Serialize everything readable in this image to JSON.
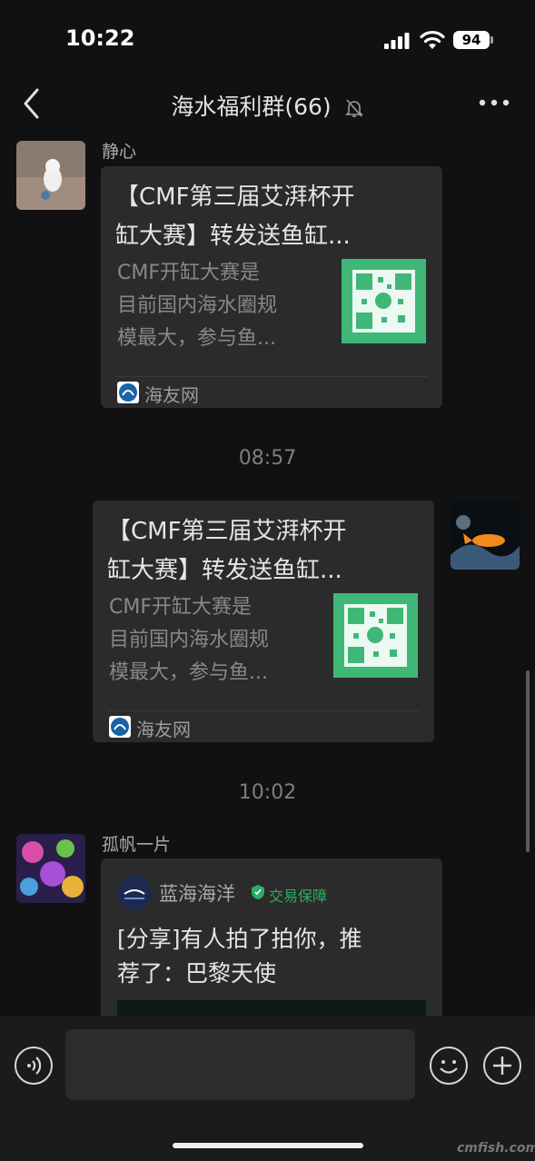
{
  "status": {
    "time": "10:22",
    "battery": "94"
  },
  "nav": {
    "title": "海水福利群(66)"
  },
  "messages": [
    {
      "sender": "静心",
      "card": {
        "title_line1": "【CMF第三届艾湃杯开",
        "title_line2": "缸大赛】转发送鱼缸...",
        "desc_line1": "CMF开缸大赛是",
        "desc_line2": "目前国内海水圈规",
        "desc_line3": "模最大，参与鱼...",
        "source": "海友网"
      }
    },
    {
      "timestamp": "08:57",
      "card": {
        "title_line1": "【CMF第三届艾湃杯开",
        "title_line2": "缸大赛】转发送鱼缸...",
        "desc_line1": "CMF开缸大赛是",
        "desc_line2": "目前国内海水圈规",
        "desc_line3": "模最大，参与鱼...",
        "source": "海友网"
      }
    },
    {
      "timestamp": "10:02",
      "sender": "孤帆一片",
      "card": {
        "shop_name": "蓝海海洋",
        "badge": "交易保障",
        "title_line1": "[分享]有人拍了拍你，推",
        "title_line2": "荐了：巴黎天使"
      }
    }
  ],
  "watermark": "cmfish.com",
  "colors": {
    "background": "#111111",
    "bubble": "#2b2b2b",
    "qr_green": "#3fb877",
    "badge_green": "#2aae67"
  }
}
